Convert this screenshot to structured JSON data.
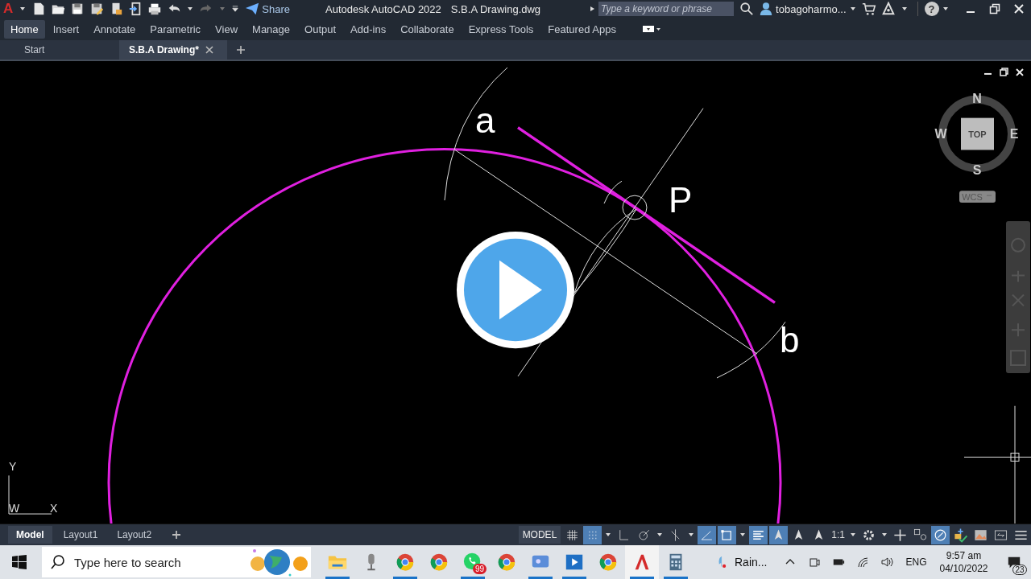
{
  "title_bar": {
    "app_logo": "A",
    "share": "Share",
    "title": "Autodesk AutoCAD 2022",
    "file_name": "S.B.A Drawing.dwg",
    "search": {
      "placeholder": "Type a keyword or phrase"
    },
    "user": "tobagoharmo...",
    "help": "?"
  },
  "ribbon_tabs": [
    {
      "label": "Home",
      "selected": true
    },
    {
      "label": "Insert",
      "selected": false
    },
    {
      "label": "Annotate",
      "selected": false
    },
    {
      "label": "Parametric",
      "selected": false
    },
    {
      "label": "View",
      "selected": false
    },
    {
      "label": "Manage",
      "selected": false
    },
    {
      "label": "Output",
      "selected": false
    },
    {
      "label": "Add-ins",
      "selected": false
    },
    {
      "label": "Collaborate",
      "selected": false
    },
    {
      "label": "Express Tools",
      "selected": false
    },
    {
      "label": "Featured Apps",
      "selected": false
    }
  ],
  "file_tabs": [
    {
      "label": "Start",
      "selected": false
    },
    {
      "label": "S.B.A Drawing*",
      "selected": true
    }
  ],
  "drawing": {
    "labels": [
      "a",
      "P",
      "b"
    ],
    "viewcube": {
      "north": "N",
      "south": "S",
      "east": "E",
      "west": "W",
      "face": "TOP",
      "coordinate_system": "WCS"
    },
    "ucs": {
      "y_axis": "Y",
      "x_axis": "X",
      "label": "W"
    }
  },
  "layout_tabs": [
    {
      "label": "Model",
      "selected": true
    },
    {
      "label": "Layout1",
      "selected": false
    },
    {
      "label": "Layout2",
      "selected": false
    }
  ],
  "status_bar": {
    "space": "MODEL",
    "tools": [
      {
        "kind": "grid",
        "on": false
      },
      {
        "kind": "snap",
        "on": true
      },
      {
        "kind": "caret"
      },
      {
        "kind": "ortho",
        "on": false
      },
      {
        "kind": "polar",
        "on": false
      },
      {
        "kind": "caret"
      },
      {
        "kind": "isodraft",
        "on": false
      },
      {
        "kind": "caret"
      },
      {
        "kind": "track",
        "on": true
      },
      {
        "kind": "osnap",
        "on": true
      },
      {
        "kind": "caret"
      },
      {
        "kind": "lineweight",
        "on": true
      },
      {
        "kind": "annotation",
        "on": true
      },
      {
        "kind": "autoscale",
        "on": false
      },
      {
        "kind": "annoscale",
        "on": false
      },
      {
        "kind": "scale",
        "text": "1:1"
      },
      {
        "kind": "caret"
      },
      {
        "kind": "gear",
        "on": false
      },
      {
        "kind": "caret"
      },
      {
        "kind": "plus",
        "on": false
      },
      {
        "kind": "isolate",
        "on": false
      },
      {
        "kind": "hardware",
        "on": true
      },
      {
        "kind": "properties",
        "on": false
      },
      {
        "kind": "graphics",
        "on": false
      },
      {
        "kind": "fullscreen",
        "on": false
      },
      {
        "kind": "menu",
        "on": false
      }
    ]
  },
  "taskbar": {
    "search": {
      "placeholder": "Type here to search"
    },
    "apps": [
      {
        "kind": "folder",
        "running": true,
        "active": false
      },
      {
        "kind": "microphone",
        "running": false,
        "active": false
      },
      {
        "kind": "browser",
        "running": true,
        "active": false
      },
      {
        "kind": "browser",
        "running": false,
        "active": false
      },
      {
        "kind": "chat",
        "running": true,
        "active": false,
        "badge": "99"
      },
      {
        "kind": "browser",
        "running": false,
        "active": false
      },
      {
        "kind": "meeting",
        "running": true,
        "active": false
      },
      {
        "kind": "video",
        "running": true,
        "active": false
      },
      {
        "kind": "browser",
        "running": false,
        "active": false
      },
      {
        "kind": "cad",
        "running": true,
        "active": true
      },
      {
        "kind": "calculator",
        "running": true,
        "active": false
      }
    ],
    "weather": "Rain...",
    "language": "ENG",
    "time": "9:57 am",
    "date": "04/10/2022",
    "notifications": "23"
  }
}
